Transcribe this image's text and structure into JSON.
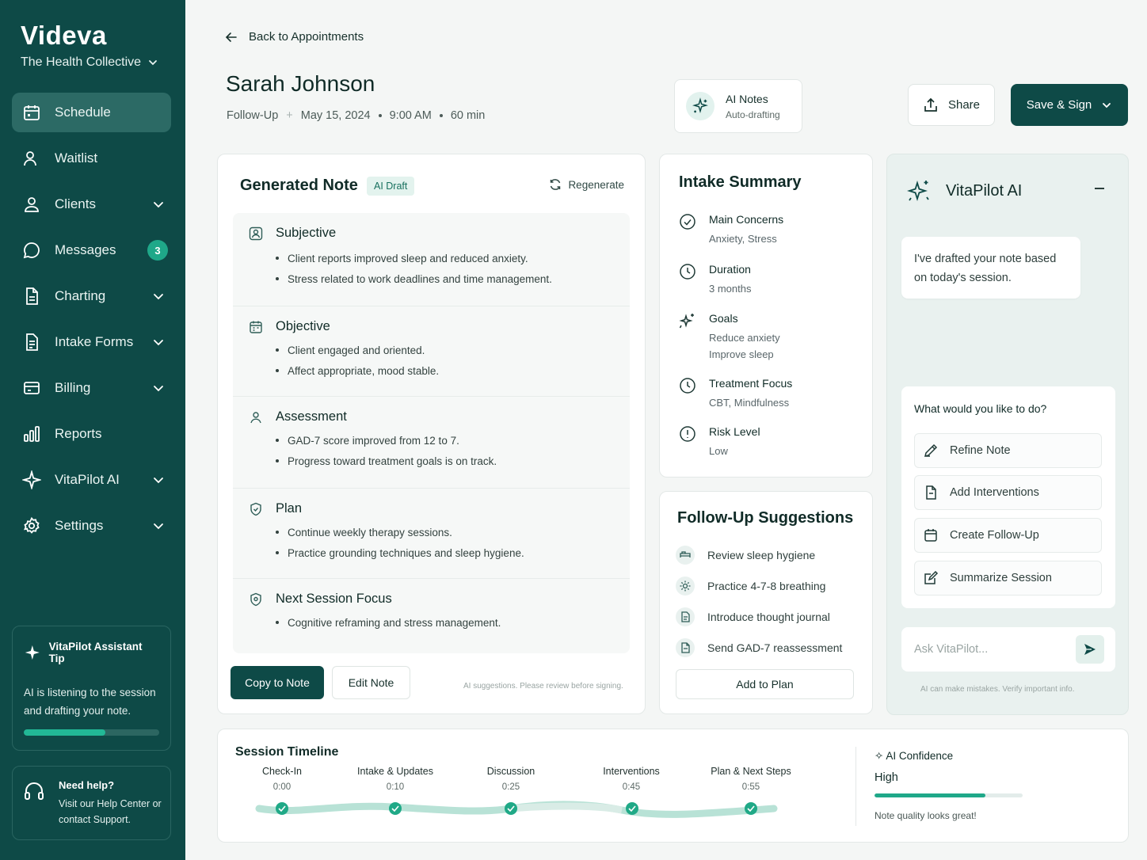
{
  "brand": {
    "name": "Videva",
    "org": "The Health Collective"
  },
  "nav": [
    {
      "label": "Schedule",
      "icon": "calendar-icon",
      "active": true
    },
    {
      "label": "Waitlist",
      "icon": "user-clock-icon"
    },
    {
      "label": "Clients",
      "icon": "user-icon",
      "expandable": true
    },
    {
      "label": "Messages",
      "icon": "chat-icon",
      "badge": "3"
    },
    {
      "label": "Charting",
      "icon": "document-icon",
      "expandable": true
    },
    {
      "label": "Intake Forms",
      "icon": "form-icon",
      "expandable": true
    },
    {
      "label": "Billing",
      "icon": "card-icon",
      "expandable": true
    },
    {
      "label": "Reports",
      "icon": "bar-chart-icon"
    },
    {
      "label": "VitaPilot AI",
      "icon": "sparkle-icon",
      "expandable": true
    },
    {
      "label": "Settings",
      "icon": "gear-icon",
      "expandable": true
    }
  ],
  "tip": {
    "title": "VitaPilot Assistant Tip",
    "text": "AI is listening to the session and drafting your note.",
    "progress": 0.6
  },
  "help": {
    "title": "Need help?",
    "text": "Visit our Help Center or contact Support."
  },
  "header": {
    "back": "Back to Appointments",
    "client_name": "Sarah Johnson",
    "type": "Follow-Up",
    "date": "May 15, 2024",
    "time": "9:00 AM",
    "duration": "60 min",
    "ai_notes_title": "AI Notes",
    "ai_notes_status": "Auto-drafting",
    "share": "Share",
    "save": "Save & Sign"
  },
  "note": {
    "title": "Generated Note",
    "badge": "AI Draft",
    "regenerate": "Regenerate",
    "sections": [
      {
        "title": "Subjective",
        "icon": "person-icon",
        "items": [
          "Client reports improved sleep and reduced anxiety.",
          "Stress related to work deadlines and time management."
        ]
      },
      {
        "title": "Objective",
        "icon": "calendar-icon",
        "items": [
          "Client engaged and oriented.",
          "Affect appropriate, mood stable."
        ]
      },
      {
        "title": "Assessment",
        "icon": "person-icon",
        "items": [
          "GAD-7 score improved from 12 to 7.",
          "Progress toward treatment goals is on track."
        ]
      },
      {
        "title": "Plan",
        "icon": "shield-icon",
        "items": [
          "Continue weekly therapy sessions.",
          "Practice grounding techniques and sleep hygiene."
        ]
      },
      {
        "title": "Next Session Focus",
        "icon": "shield-icon",
        "items": [
          "Cognitive reframing and stress management."
        ]
      }
    ],
    "copy": "Copy to Note",
    "edit": "Edit Note",
    "disclaimer": "AI suggestions. Please review before signing."
  },
  "intake": {
    "title": "Intake Summary",
    "items": [
      {
        "label": "Main Concerns",
        "value": "Anxiety, Stress",
        "icon": "check-circle-icon"
      },
      {
        "label": "Duration",
        "value": "3 months",
        "icon": "clock-icon"
      },
      {
        "label": "Goals",
        "value": "Reduce anxiety\nImprove sleep",
        "icon": "sparkle-icon"
      },
      {
        "label": "Treatment Focus",
        "value": "CBT, Mindfulness",
        "icon": "clock-icon"
      },
      {
        "label": "Risk Level",
        "value": "Low",
        "icon": "info-circle-icon"
      }
    ]
  },
  "followup": {
    "title": "Follow-Up Suggestions",
    "items": [
      {
        "label": "Review sleep hygiene",
        "icon": "bed-icon"
      },
      {
        "label": "Practice 4-7-8 breathing",
        "icon": "sun-icon"
      },
      {
        "label": "Introduce thought journal",
        "icon": "journal-icon"
      },
      {
        "label": "Send GAD-7 reassessment",
        "icon": "document-icon"
      }
    ],
    "add": "Add to Plan"
  },
  "pilot": {
    "title": "VitaPilot AI",
    "message": "I've drafted your note based on today's session.",
    "prompt": "What would you like to do?",
    "actions": [
      {
        "label": "Refine Note",
        "icon": "pencil-icon"
      },
      {
        "label": "Add Interventions",
        "icon": "document-icon"
      },
      {
        "label": "Create Follow-Up",
        "icon": "calendar-icon"
      },
      {
        "label": "Summarize Session",
        "icon": "edit-icon"
      }
    ],
    "placeholder": "Ask VitaPilot...",
    "disclaimer": "AI can make mistakes. Verify important info."
  },
  "timeline": {
    "title": "Session Timeline",
    "steps": [
      {
        "label": "Check-In",
        "time": "0:00"
      },
      {
        "label": "Intake & Updates",
        "time": "0:10"
      },
      {
        "label": "Discussion",
        "time": "0:25"
      },
      {
        "label": "Interventions",
        "time": "0:45"
      },
      {
        "label": "Plan & Next Steps",
        "time": "0:55"
      }
    ]
  },
  "confidence": {
    "title": "✧ AI Confidence",
    "level": "High",
    "value": 0.75,
    "note": "Note quality looks great!"
  },
  "colors": {
    "sidebar": "#0e4a47",
    "accent": "#1fa889",
    "primary_button": "#0e4a47"
  }
}
